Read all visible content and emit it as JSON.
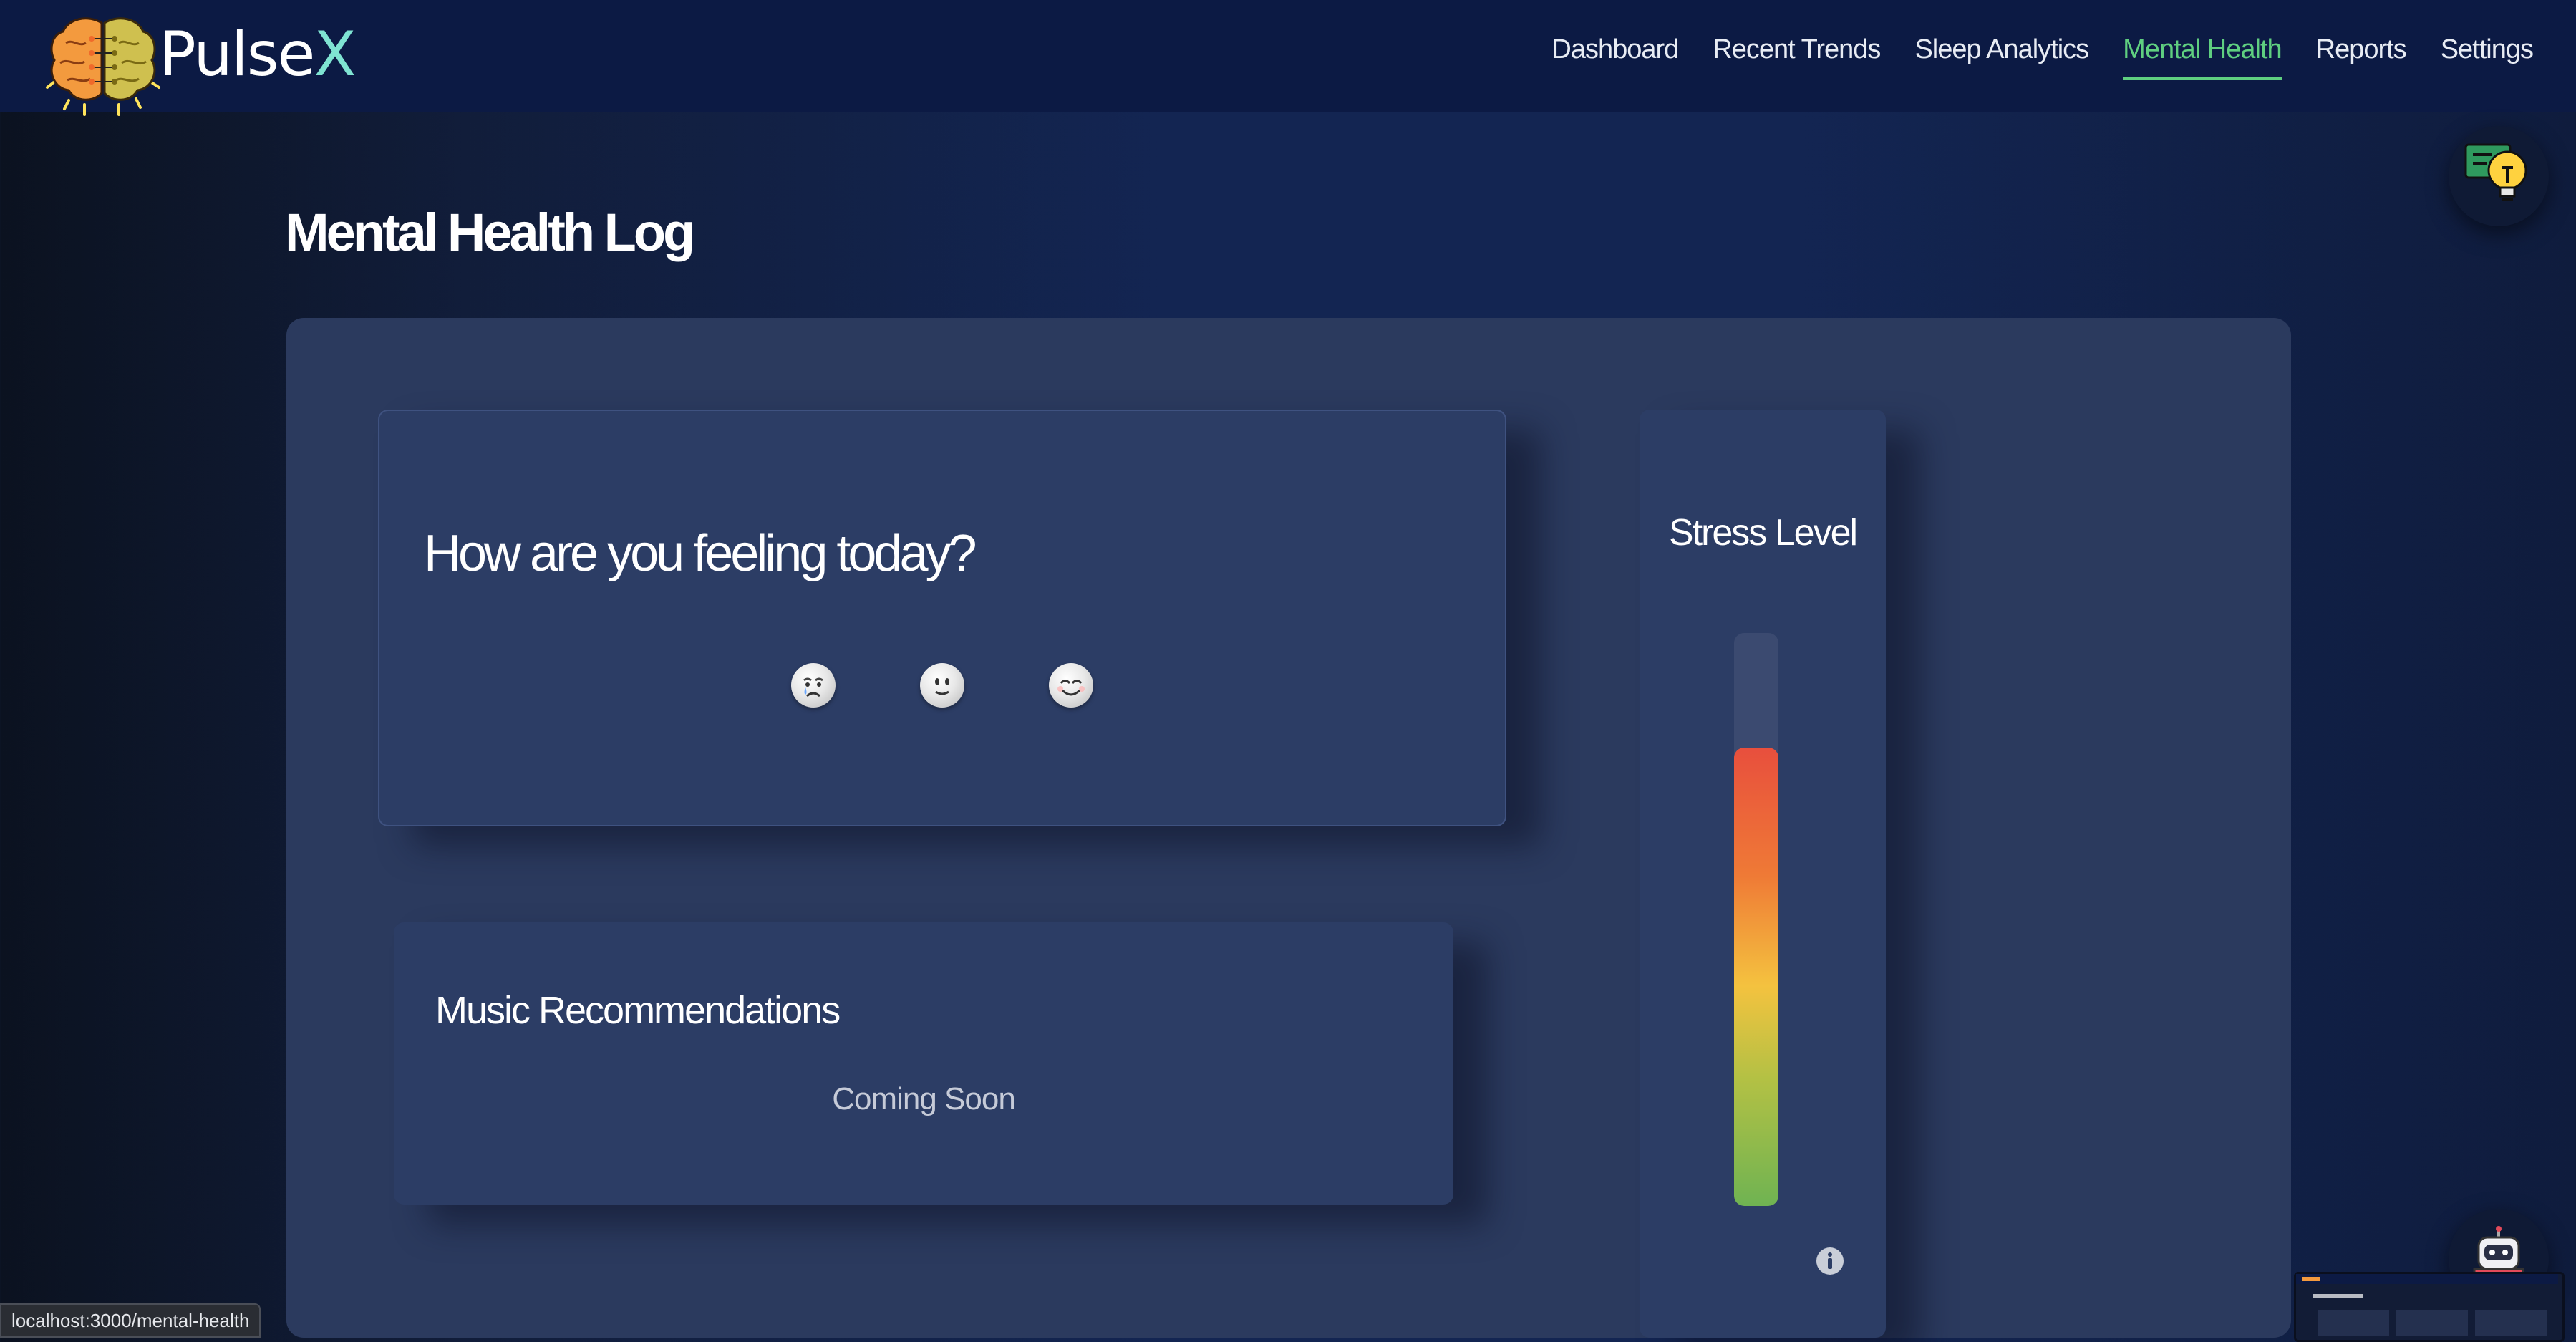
{
  "app": {
    "brand_prefix": "Pulse",
    "brand_suffix": "X"
  },
  "nav": {
    "items": [
      {
        "label": "Dashboard",
        "active": false
      },
      {
        "label": "Recent Trends",
        "active": false
      },
      {
        "label": "Sleep Analytics",
        "active": false
      },
      {
        "label": "Mental Health",
        "active": true
      },
      {
        "label": "Reports",
        "active": false
      },
      {
        "label": "Settings",
        "active": false
      }
    ]
  },
  "page": {
    "title": "Mental Health Log"
  },
  "feeling": {
    "question": "How are you feeling today?",
    "moods": [
      "sad-face-icon",
      "neutral-face-icon",
      "happy-face-icon"
    ]
  },
  "music": {
    "title": "Music Recommendations",
    "status": "Coming Soon"
  },
  "stress": {
    "title": "Stress Level",
    "level_fraction": 0.8,
    "colors": [
      "#e84f3d",
      "#f4c23f",
      "#6fb352"
    ]
  },
  "status_bar": {
    "url": "localhost:3000/mental-health"
  },
  "colors": {
    "accent": "#5fcf80",
    "navbar": "#0c1a44",
    "panel": "#2b3a5e"
  }
}
